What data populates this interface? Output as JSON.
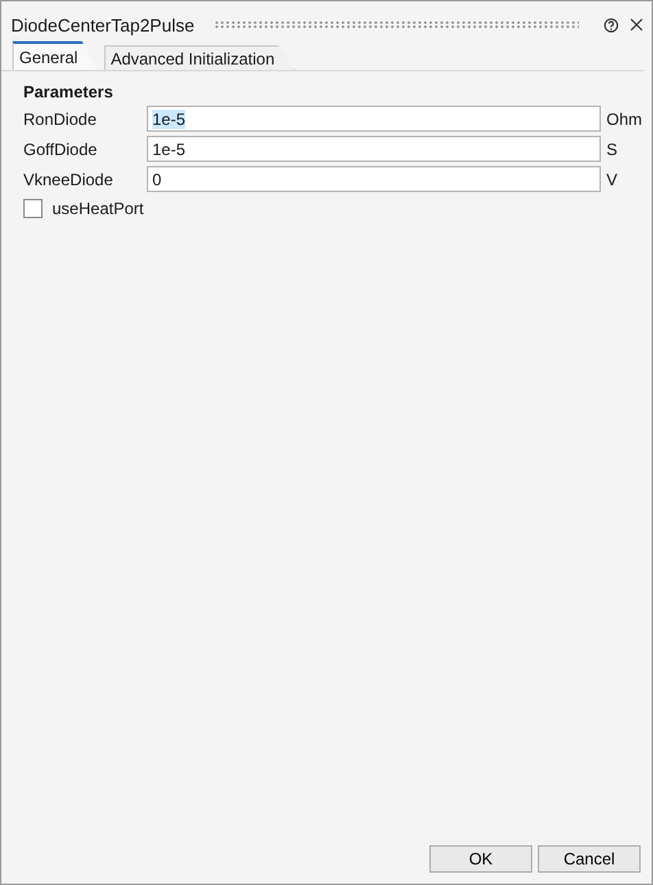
{
  "window": {
    "title": "DiodeCenterTap2Pulse"
  },
  "tabs": [
    {
      "label": "General",
      "selected": true
    },
    {
      "label": "Advanced Initialization",
      "selected": false
    }
  ],
  "section": {
    "title": "Parameters"
  },
  "parameters": [
    {
      "name": "RonDiode",
      "value": "1e-5",
      "unit": "Ohm",
      "highlighted": true
    },
    {
      "name": "GoffDiode",
      "value": "1e-5",
      "unit": "S",
      "highlighted": false
    },
    {
      "name": "VkneeDiode",
      "value": "0",
      "unit": "V",
      "highlighted": false
    }
  ],
  "checkboxes": [
    {
      "label": "useHeatPort",
      "checked": false
    }
  ],
  "buttons": [
    "OK",
    "Cancel"
  ]
}
